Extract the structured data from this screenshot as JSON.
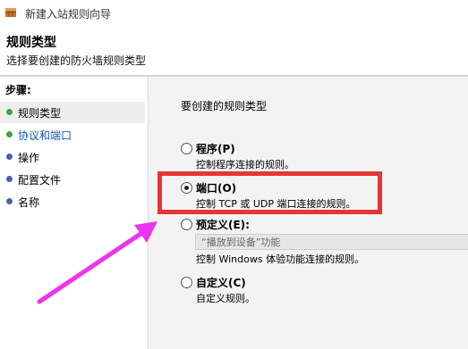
{
  "window": {
    "title": "新建入站规则向导"
  },
  "header": {
    "title": "规则类型",
    "subtitle": "选择要创建的防火墙规则类型"
  },
  "sidebar": {
    "heading": "步骤:",
    "items": [
      {
        "label": "规则类型",
        "dot_color": "#3aa640",
        "active": true
      },
      {
        "label": "协议和端口",
        "dot_color": "#3aa640",
        "link": true
      },
      {
        "label": "操作",
        "dot_color": "#4a60b0"
      },
      {
        "label": "配置文件",
        "dot_color": "#4a60b0"
      },
      {
        "label": "名称",
        "dot_color": "#4a60b0"
      }
    ]
  },
  "main": {
    "heading": "要创建的规则类型",
    "options": [
      {
        "title": "程序(P)",
        "desc": "控制程序连接的规则。",
        "checked": false
      },
      {
        "title": "端口(O)",
        "desc": "控制 TCP 或 UDP 端口连接的规则。",
        "checked": true
      },
      {
        "title": "预定义(E):",
        "desc": "控制 Windows 体验功能连接的规则。",
        "checked": false
      },
      {
        "title": "自定义(C)",
        "desc": "自定义规则。",
        "checked": false
      }
    ],
    "predefined_combo_value": "“播放到设备”功能"
  },
  "colors": {
    "highlight": "#e53535",
    "arrow": "#ee33ee",
    "link": "#1a56b4"
  }
}
